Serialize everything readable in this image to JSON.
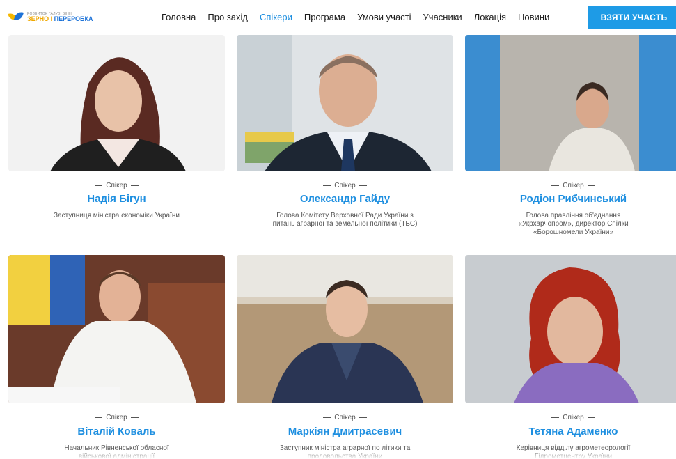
{
  "header": {
    "logo_top": "Розвиток галузі Вінні",
    "logo_brand_a": "ЗЕРНО",
    "logo_brand_sep": " І ",
    "logo_brand_b": "ПЕРЕРОБКА",
    "nav": [
      "Головна",
      "Про захід",
      "Спікери",
      "Програма",
      "Умови участі",
      "Учасники",
      "Локація",
      "Новини"
    ],
    "active_nav": "Спікери",
    "cta_label": "ВЗЯТИ УЧАСТЬ"
  },
  "colors": {
    "accent": "#1e8fe0",
    "cta": "#1e9be6",
    "text": "#1c1c1c",
    "muted": "#555555"
  },
  "speakers": [
    {
      "role": "Спікер",
      "name": "Надія Бігун",
      "desc": "Заступниця міністра економіки України"
    },
    {
      "role": "Спікер",
      "name": "Олександр Гайду",
      "desc": "Голова Комітету Верховної Ради України з питань аграрної та земельної політики (ТБС)"
    },
    {
      "role": "Спікер",
      "name": "Родіон Рибчинський",
      "desc": "Голова правління об'єднання «Укрхарчопром», директор Спілки «Борошномели України»"
    },
    {
      "role": "Спікер",
      "name": "Віталій Коваль",
      "desc": "Начальник Рівненської обласної військової адміністрації"
    },
    {
      "role": "Спікер",
      "name": "Маркіян Дмитрасевич",
      "desc": "Заступник міністра аграрної по літики та продовольства України"
    },
    {
      "role": "Спікер",
      "name": "Тетяна Адаменко",
      "desc": "Керівниця відділу агрометеорології Гідрометцентру України"
    }
  ]
}
